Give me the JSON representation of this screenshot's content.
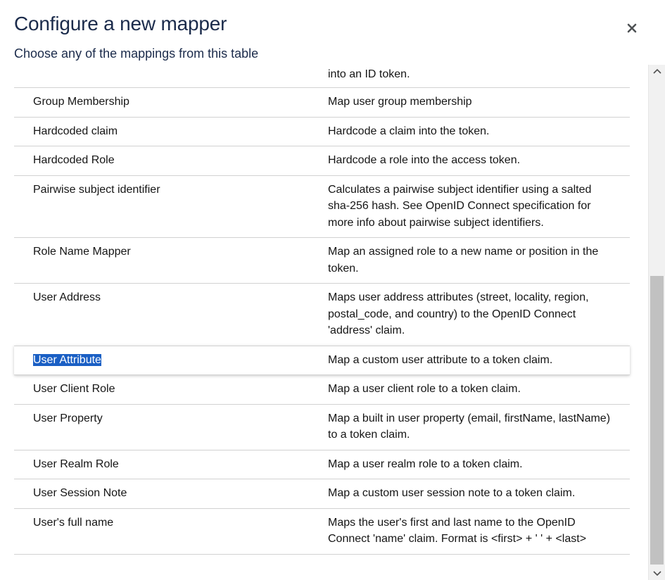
{
  "modal": {
    "title": "Configure a new mapper",
    "subtitle": "Choose any of the mappings from this table",
    "close_icon": "close-icon"
  },
  "table": {
    "partial_desc": "into an ID token.",
    "selected_index": 6,
    "rows": [
      {
        "name": "Group Membership",
        "desc": "Map user group membership"
      },
      {
        "name": "Hardcoded claim",
        "desc": "Hardcode a claim into the token."
      },
      {
        "name": "Hardcoded Role",
        "desc": "Hardcode a role into the access token."
      },
      {
        "name": "Pairwise subject identifier",
        "desc": "Calculates a pairwise subject identifier using a salted sha-256 hash. See OpenID Connect specification for more info about pairwise subject identifiers."
      },
      {
        "name": "Role Name Mapper",
        "desc": "Map an assigned role to a new name or position in the token."
      },
      {
        "name": "User Address",
        "desc": "Maps user address attributes (street, locality, region, postal_code, and country) to the OpenID Connect 'address' claim."
      },
      {
        "name": "User Attribute",
        "desc": "Map a custom user attribute to a token claim."
      },
      {
        "name": "User Client Role",
        "desc": "Map a user client role to a token claim."
      },
      {
        "name": "User Property",
        "desc": "Map a built in user property (email, firstName, lastName) to a token claim."
      },
      {
        "name": "User Realm Role",
        "desc": "Map a user realm role to a token claim."
      },
      {
        "name": "User Session Note",
        "desc": "Map a custom user session note to a token claim."
      },
      {
        "name": "User's full name",
        "desc": "Maps the user's first and last name to the OpenID Connect 'name' claim. Format is <first> + ' ' + <last>"
      }
    ]
  },
  "colors": {
    "title": "#1b2b4b",
    "highlight": "#1a5fc4",
    "divider": "#d2d2d2"
  }
}
